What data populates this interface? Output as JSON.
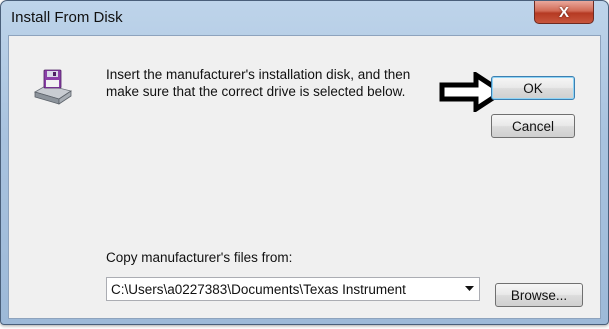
{
  "window": {
    "title": "Install From Disk",
    "close_label": "X"
  },
  "dialog": {
    "instructions": "Insert the manufacturer's installation disk, and then make sure that the correct drive is selected below.",
    "ok_label": "OK",
    "cancel_label": "Cancel",
    "copy_label": "Copy manufacturer's files from:",
    "path_value": "C:\\Users\\a0227383\\Documents\\Texas Instrument",
    "browse_label": "Browse..."
  },
  "icons": {
    "disk": "floppy-disk-drive-icon",
    "annotation": "arrow-pointing-right",
    "dropdown": "chevron-down-icon"
  },
  "colors": {
    "close_button": "#c8563d",
    "titlebar": "#a9c3df",
    "default_button_border": "#3c7fb1"
  }
}
